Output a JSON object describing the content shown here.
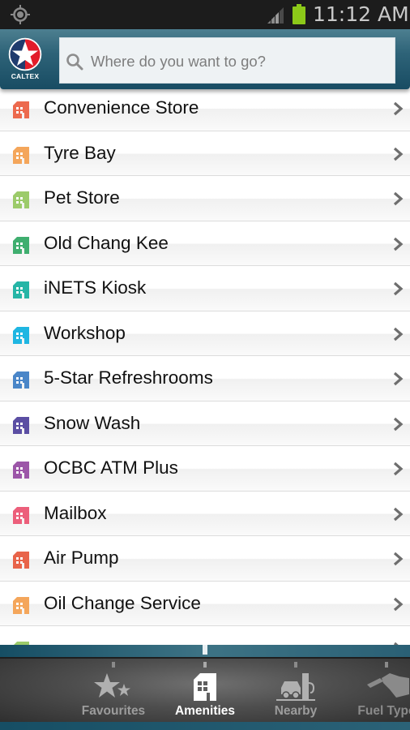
{
  "status_bar": {
    "time": "11:12 AM",
    "icons": [
      "gps-icon",
      "signal-icon",
      "battery-icon"
    ],
    "battery_color": "#8cc919"
  },
  "header": {
    "logo_text": "CALTEX",
    "logo_colors": {
      "red": "#e21c2a",
      "navy": "#1f3b6e"
    },
    "search": {
      "placeholder": "Where do you want to go?",
      "value": "",
      "icon": "search-icon"
    }
  },
  "amenities": [
    {
      "label": "Convenience Store",
      "icon": "building-icon",
      "color": "#ec6a4e"
    },
    {
      "label": "Tyre Bay",
      "icon": "building-icon",
      "color": "#f4a65b"
    },
    {
      "label": "Pet Store",
      "icon": "building-icon",
      "color": "#9ccb6a"
    },
    {
      "label": "Old Chang Kee",
      "icon": "building-icon",
      "color": "#3fae6f"
    },
    {
      "label": "iNETS Kiosk",
      "icon": "building-icon",
      "color": "#26b5a6"
    },
    {
      "label": "Workshop",
      "icon": "building-icon",
      "color": "#1fb6e2"
    },
    {
      "label": "5-Star Refreshrooms",
      "icon": "building-icon",
      "color": "#4a86c8"
    },
    {
      "label": "Snow Wash",
      "icon": "building-icon",
      "color": "#5b4ea3"
    },
    {
      "label": "OCBC ATM Plus",
      "icon": "building-icon",
      "color": "#9c56a8"
    },
    {
      "label": "Mailbox",
      "icon": "building-icon",
      "color": "#ec5f7b"
    },
    {
      "label": "Air Pump",
      "icon": "building-icon",
      "color": "#e8644a"
    },
    {
      "label": "Oil Change Service",
      "icon": "building-icon",
      "color": "#f4a65b"
    },
    {
      "label": "",
      "icon": "building-icon",
      "color": "#9ccb6a"
    }
  ],
  "tabs": [
    {
      "label": "Favourites",
      "icon": "stars-icon",
      "active": false
    },
    {
      "label": "Amenities",
      "icon": "building-icon",
      "active": true
    },
    {
      "label": "Nearby",
      "icon": "car-pump-icon",
      "active": false
    },
    {
      "label": "Fuel Type",
      "icon": "fuel-nozzle-icon",
      "active": false
    }
  ]
}
